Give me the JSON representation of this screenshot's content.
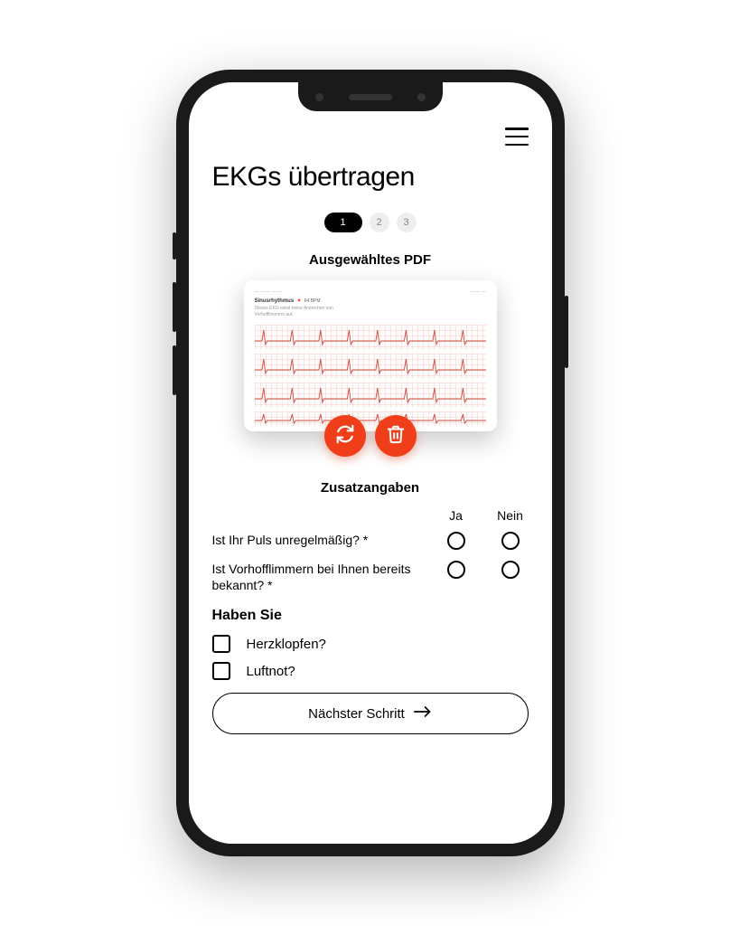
{
  "header": {
    "title": "EKGs übertragen"
  },
  "stepper": {
    "active": "1",
    "inactive": [
      "2",
      "3"
    ]
  },
  "pdf": {
    "section_label": "Ausgewähltes PDF",
    "preview": {
      "sinus_label": "Sinusrhythmus",
      "bpm": "64 BPM",
      "note_line1": "Dieses EKG weist keine Anzeichen von",
      "note_line2": "Vorhofflimmern auf."
    }
  },
  "extras": {
    "section_label": "Zusatzangaben",
    "yes_label": "Ja",
    "no_label": "Nein",
    "q1": "Ist Ihr Puls unregelmäßig?  *",
    "q2": "Ist Vorhofflimmern bei Ihnen bereits bekannt?  *"
  },
  "symptoms": {
    "heading": "Haben Sie",
    "opt1": "Herzklopfen?",
    "opt2": "Luftnot?"
  },
  "next_button": "Nächster Schritt",
  "colors": {
    "accent": "#f03e1b"
  }
}
